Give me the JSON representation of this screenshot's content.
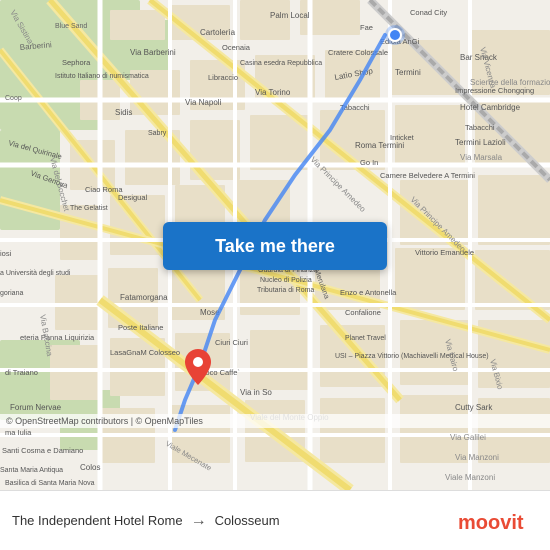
{
  "map": {
    "background_color": "#f2efe9",
    "origin_label": "origin-dot",
    "destination_label": "destination-pin"
  },
  "button": {
    "label": "Take me there"
  },
  "bottom_bar": {
    "from": "The Independent Hotel Rome",
    "arrow": "→",
    "to": "Colosseum"
  },
  "copyright": {
    "text": "© OpenStreetMap contributors | © OpenMapTiles"
  },
  "moovit": {
    "label": "moovit"
  }
}
